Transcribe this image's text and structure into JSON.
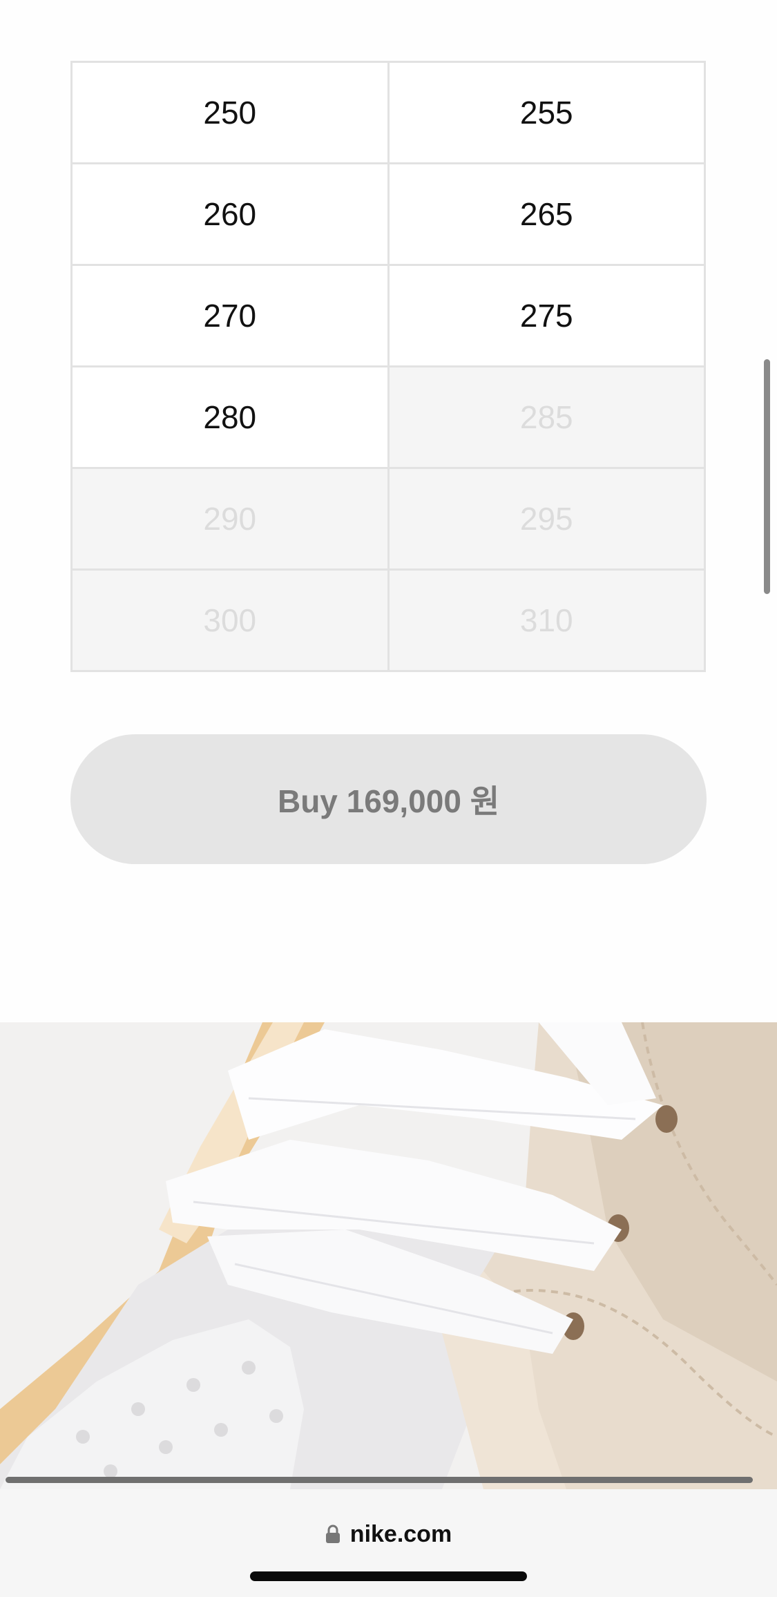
{
  "sizes": [
    {
      "label": "250",
      "available": true
    },
    {
      "label": "255",
      "available": true
    },
    {
      "label": "260",
      "available": true
    },
    {
      "label": "265",
      "available": true
    },
    {
      "label": "270",
      "available": true
    },
    {
      "label": "275",
      "available": true
    },
    {
      "label": "280",
      "available": true
    },
    {
      "label": "285",
      "available": false
    },
    {
      "label": "290",
      "available": false
    },
    {
      "label": "295",
      "available": false
    },
    {
      "label": "300",
      "available": false
    },
    {
      "label": "310",
      "available": false
    }
  ],
  "buy_button": {
    "label": "Buy 169,000 원"
  },
  "product_image": {
    "icon": "shoe-closeup-image"
  },
  "browser": {
    "url": "nike.com",
    "lock_icon": "lock-icon"
  },
  "colors": {
    "available_text": "#111111",
    "unavailable_text": "#dcdcdc",
    "unavailable_bg": "#f5f5f5",
    "button_bg": "#e5e5e5",
    "button_text": "#7a7a7a"
  }
}
